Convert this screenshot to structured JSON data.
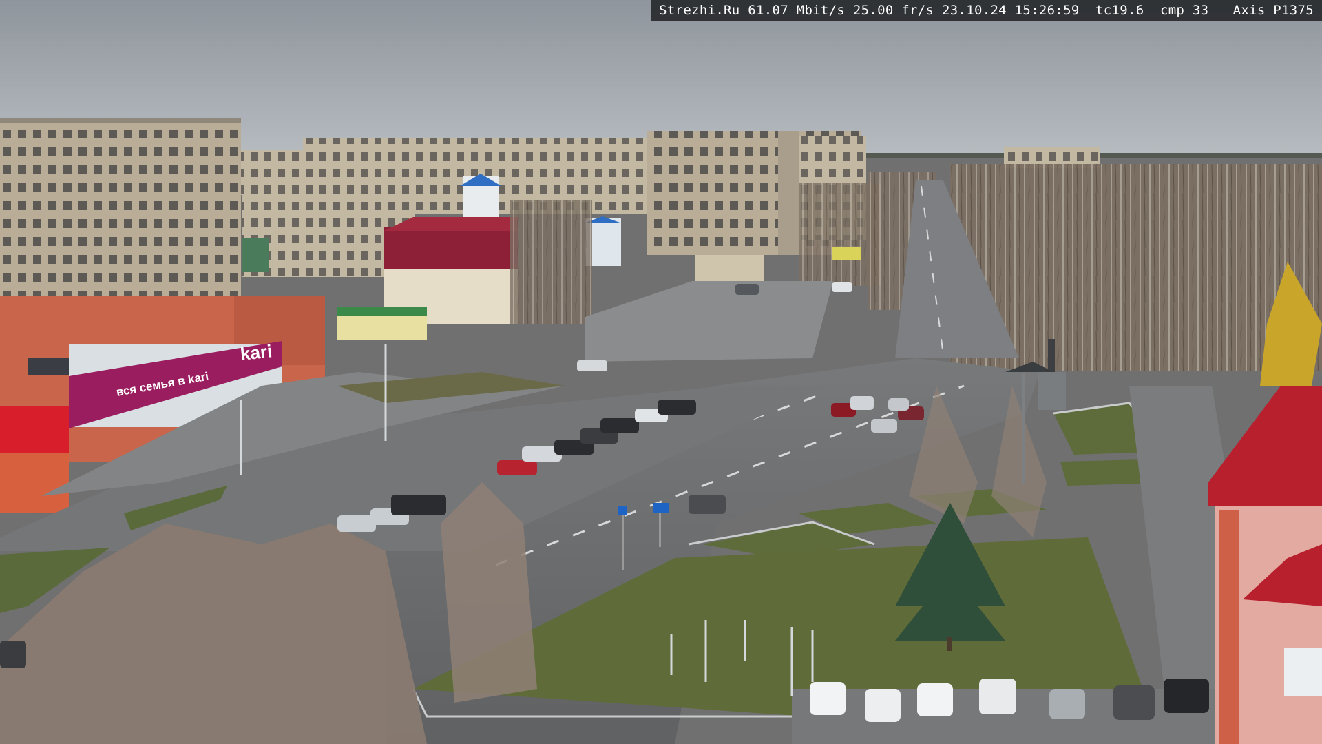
{
  "overlay": {
    "text": "Strezhi.Ru 61.07 Mbit/s 25.00 fr/s 23.10.24 15:26:59  tc19.6  cmp 33   Axis P1375"
  },
  "signs": {
    "store_brand": "kari",
    "store_slogan": "вся семья в kari",
    "store_slogan_brand": "kari"
  },
  "colors": {
    "sky": "#a9afb6",
    "asphalt": "#6c6e70",
    "grass": "#5c6b3a",
    "kari_magenta": "#9a1e5f",
    "roof_red": "#b8202e",
    "brick": "#c8654a"
  }
}
